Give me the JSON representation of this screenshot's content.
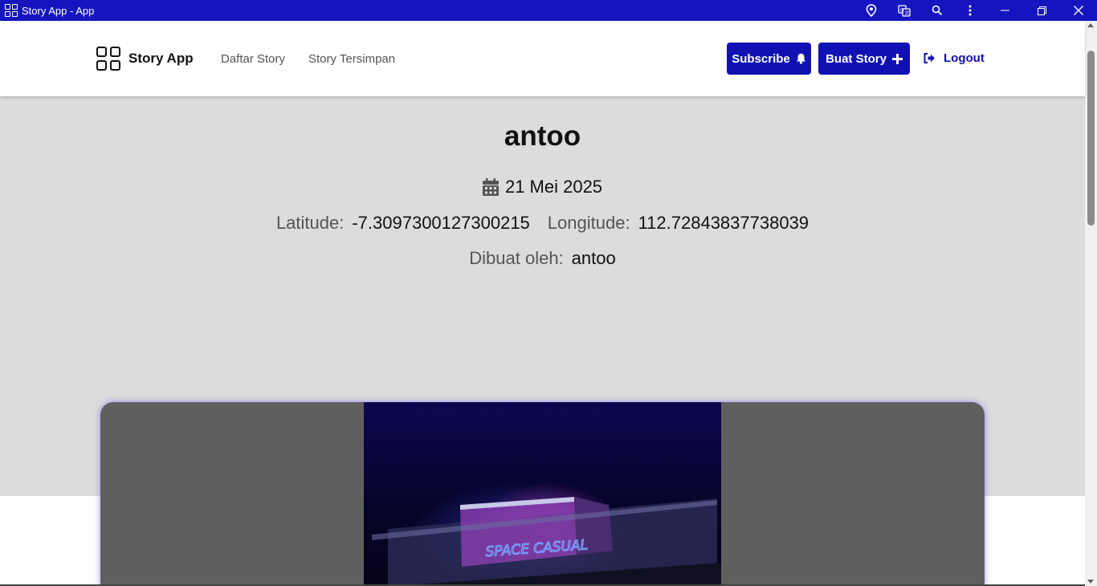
{
  "window": {
    "title": "Story App - App",
    "icons": [
      "location-icon",
      "translate-icon",
      "zoom-icon",
      "more-vert-icon",
      "minimize-icon",
      "restore-icon",
      "close-icon"
    ]
  },
  "header": {
    "brand": "Story App",
    "nav": [
      "Daftar Story",
      "Story Tersimpan"
    ],
    "subscribe_label": "Subscribe",
    "create_label": "Buat Story",
    "logout_label": "Logout"
  },
  "story": {
    "title": "antoo",
    "date": "21 Mei 2025",
    "latitude_label": "Latitude:",
    "latitude": "-7.3097300127300215",
    "longitude_label": "Longitude:",
    "longitude": "112.72843837738039",
    "author_label": "Dibuat oleh:",
    "author": "antoo",
    "photo_sign_text": "SPACE CASUAL"
  },
  "colors": {
    "titlebar": "#1515c0",
    "primary": "#1111b3",
    "detail_bg": "#dcdcdc",
    "card_bg": "#5f5f5f"
  }
}
